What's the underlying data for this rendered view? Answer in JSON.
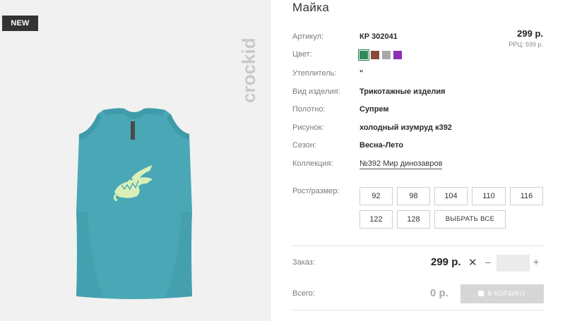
{
  "gallery": {
    "badge": "NEW",
    "brand": "crockid"
  },
  "product": {
    "title": "Майка",
    "price": "299 р.",
    "rrp": "РРЦ: 599 р.",
    "details": [
      {
        "label": "Артикул:",
        "value": "КР 302041"
      },
      {
        "label": "Цвет:",
        "value": ""
      },
      {
        "label": "Утеплитель:",
        "value": "\""
      },
      {
        "label": "Вид изделия:",
        "value": "Трикотажные изделия"
      },
      {
        "label": "Полотно:",
        "value": "Супрем"
      },
      {
        "label": "Рисунок:",
        "value": "холодный изумруд к392"
      },
      {
        "label": "Сезон:",
        "value": "Весна-Лето"
      },
      {
        "label": "Коллекция:",
        "value": "№392 Мир динозавров"
      }
    ],
    "colors": [
      "#2e8a5c",
      "#8a4a3a",
      "#a8a8a8",
      "#8a2fb8"
    ],
    "active_color_index": 0
  },
  "sizes": {
    "label": "Рост/размер:",
    "options": [
      "92",
      "98",
      "104",
      "110",
      "116",
      "122",
      "128"
    ],
    "select_all": "ВЫБРАТЬ ВСЕ"
  },
  "order": {
    "label": "Заказ:",
    "price": "299 р.",
    "times": "✕",
    "minus": "–",
    "plus": "+",
    "quantity": ""
  },
  "total": {
    "label": "Всего:",
    "value": "0 р.",
    "cart_button": "В КОРЗИНУ"
  },
  "accent_colors": {
    "shirt": "#4aa8b6",
    "crocodile": "#d8f0b8",
    "badge_bg": "#333333",
    "cart_disabled": "#d6d6d6"
  }
}
